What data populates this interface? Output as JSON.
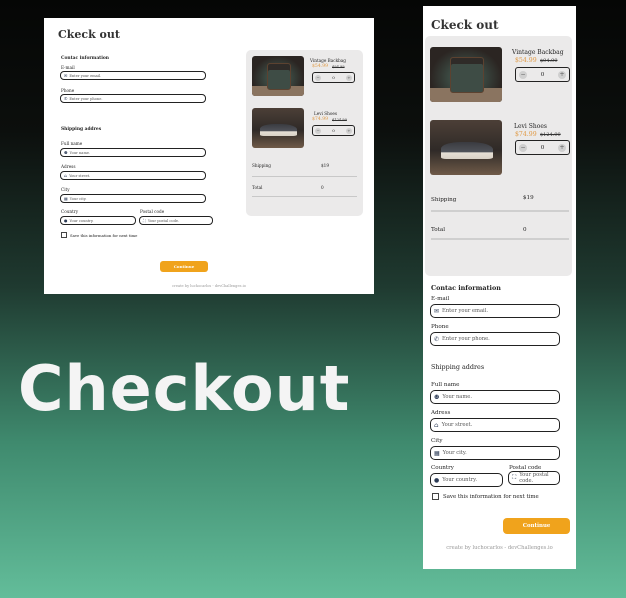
{
  "hero_title": "Checkout",
  "colors": {
    "accent": "#f0a31c",
    "price": "#e09a45",
    "panel": "#ebeaea"
  },
  "desktop": {
    "title": "Ckeck out",
    "contact_heading": "Contac information",
    "email_label": "E-mail",
    "email_placeholder": "Enter your email.",
    "phone_label": "Phone",
    "phone_placeholder": "Enter your phone.",
    "shipping_heading": "Shipping addres",
    "fullname_label": "Full name",
    "fullname_placeholder": "Your name.",
    "address_label": "Adress",
    "address_placeholder": "Your street.",
    "city_label": "City",
    "city_placeholder": "Your city.",
    "country_label": "Country",
    "country_placeholder": "Your country.",
    "postal_label": "Postal code",
    "postal_placeholder": "Your postal code.",
    "save_label": "Save this information for next time",
    "continue_label": "Continue",
    "credit": "create by luchocarlos - devChallenges.io",
    "products": [
      {
        "name": "Vintage Backbag",
        "price": "$54.99",
        "old_price": "$94.99",
        "qty": "0",
        "image": "backpack-photo"
      },
      {
        "name": "Levi Shoes",
        "price": "$74.99",
        "old_price": "$124.99",
        "qty": "0",
        "image": "shoes-photo"
      }
    ],
    "shipping_label": "Shipping",
    "shipping_value": "$19",
    "total_label": "Total",
    "total_value": "0"
  },
  "mobile": {
    "title": "Ckeck out",
    "contact_heading": "Contac information",
    "email_label": "E-mail",
    "email_placeholder": "Enter your email.",
    "phone_label": "Phone",
    "phone_placeholder": "Enter your phone.",
    "shipping_heading": "Shipping addres",
    "fullname_label": "Full name",
    "fullname_placeholder": "Your name.",
    "address_label": "Adress",
    "address_placeholder": "Your street.",
    "city_label": "City",
    "city_placeholder": "Your city.",
    "country_label": "Country",
    "country_placeholder": "Your country.",
    "postal_label": "Postal code",
    "postal_placeholder": "Your postal code.",
    "save_label": "Save this information for next time",
    "continue_label": "Continue",
    "credit": "create by luchocarlos - devChallenges.io",
    "products": [
      {
        "name": "Vintage Backbag",
        "price": "$54.99",
        "old_price": "$94.99",
        "qty": "0",
        "image": "backpack-photo"
      },
      {
        "name": "Levi Shoes",
        "price": "$74.99",
        "old_price": "$124.99",
        "qty": "0",
        "image": "shoes-photo"
      }
    ],
    "shipping_label": "Shipping",
    "shipping_value": "$19",
    "total_label": "Total",
    "total_value": "0"
  }
}
